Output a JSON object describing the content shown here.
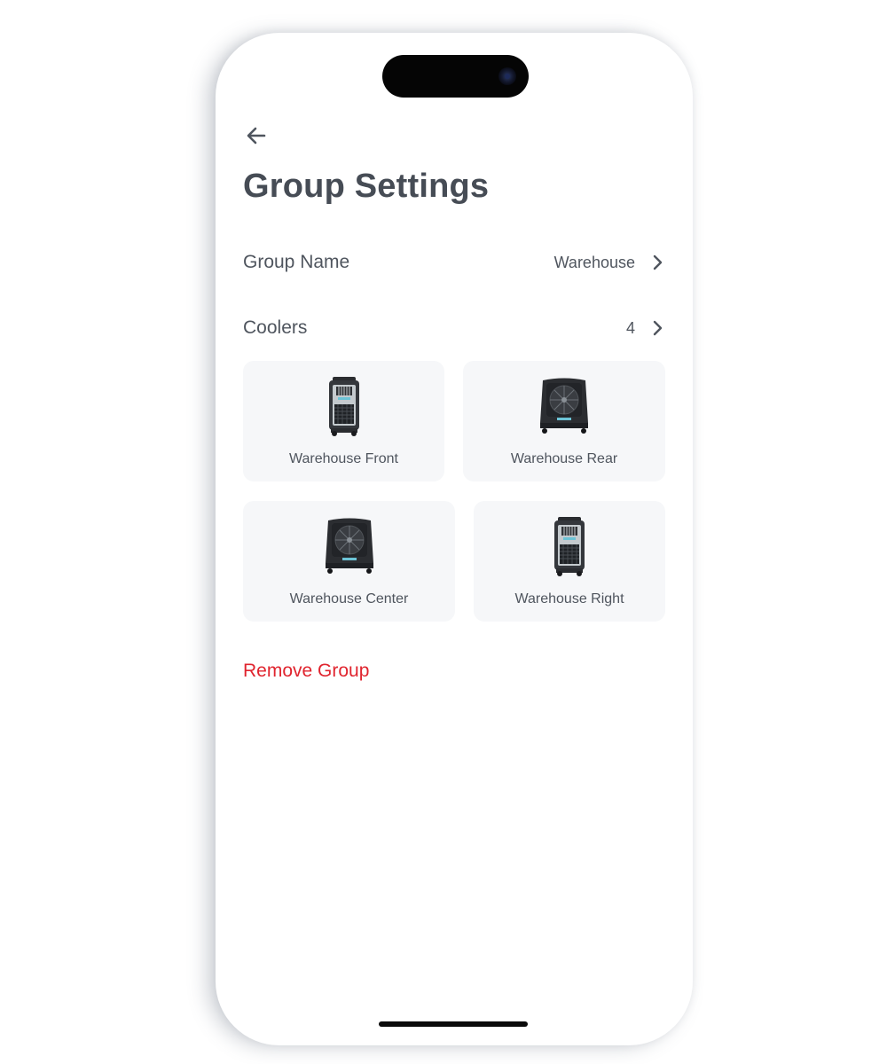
{
  "header": {
    "back_icon": "arrow-left-icon",
    "title": "Group Settings"
  },
  "group_name_row": {
    "label": "Group Name",
    "value": "Warehouse",
    "icon": "chevron-right-icon"
  },
  "coolers_row": {
    "label": "Coolers",
    "value": "4",
    "icon": "chevron-right-icon"
  },
  "coolers": [
    {
      "name": "Warehouse Front",
      "model": "tall-cooler-icon"
    },
    {
      "name": "Warehouse Rear",
      "model": "wide-cooler-icon"
    },
    {
      "name": "Warehouse Center",
      "model": "wide-cooler-icon"
    },
    {
      "name": "Warehouse Right",
      "model": "tall-cooler-icon"
    }
  ],
  "actions": {
    "remove_group": "Remove Group"
  },
  "colors": {
    "text": "#4f555e",
    "title": "#464c55",
    "card_bg": "#f6f7f9",
    "danger": "#e0242e"
  }
}
